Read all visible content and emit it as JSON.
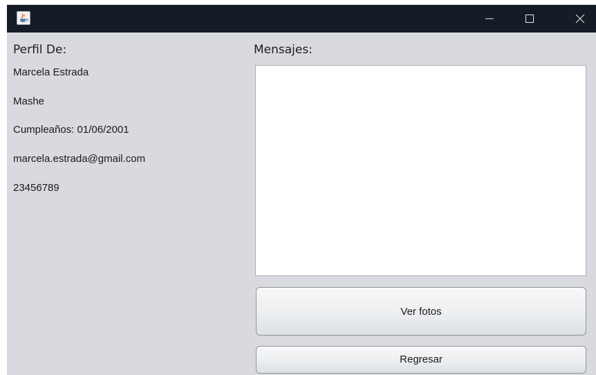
{
  "window": {
    "title": "",
    "icon": "java-cup-icon",
    "controls": [
      "minimize-icon",
      "maximize-icon",
      "close-icon"
    ]
  },
  "profile": {
    "heading": "Perfil De:",
    "name": "Marcela Estrada",
    "nickname": "Mashe",
    "birthday": "Cumpleaños: 01/06/2001",
    "email": "marcela.estrada@gmail.com",
    "phone": "23456789"
  },
  "messages": {
    "heading": "Mensajes:",
    "text": ""
  },
  "buttons": {
    "view_photos": "Ver fotos",
    "back": "Regresar"
  },
  "colors": {
    "titlebar": "#151c26",
    "window_background": "#d9dadf",
    "text_area": "#ffffff"
  }
}
